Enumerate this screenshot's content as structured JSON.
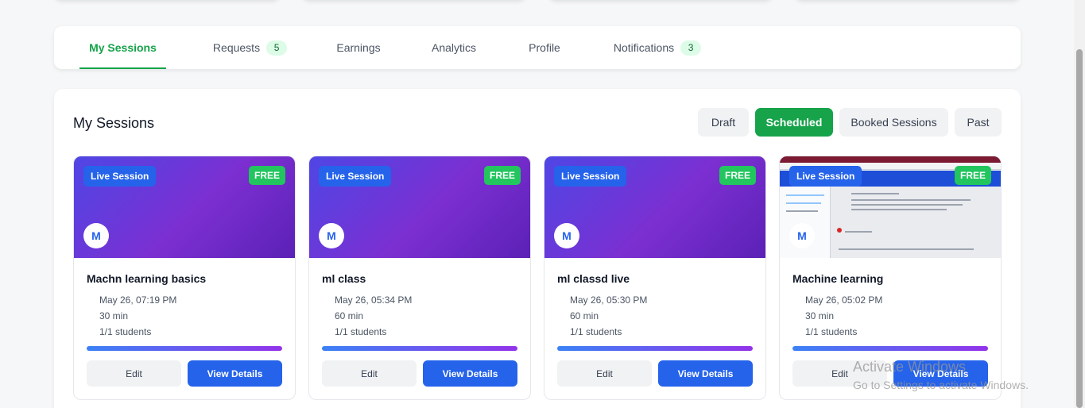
{
  "tabs": [
    {
      "label": "My Sessions",
      "active": true
    },
    {
      "label": "Requests",
      "count": "5"
    },
    {
      "label": "Earnings"
    },
    {
      "label": "Analytics"
    },
    {
      "label": "Profile"
    },
    {
      "label": "Notifications",
      "count": "3"
    }
  ],
  "panel": {
    "title": "My Sessions",
    "filters": [
      "Draft",
      "Scheduled",
      "Booked Sessions",
      "Past"
    ],
    "active_filter": "Scheduled"
  },
  "sessions": [
    {
      "badge": "Live Session",
      "price": "FREE",
      "avatar": "M",
      "title": "Machn learning basics",
      "datetime": "May 26, 07:19 PM",
      "duration": "30 min",
      "students": "1/1 students",
      "edit": "Edit",
      "view": "View Details"
    },
    {
      "badge": "Live Session",
      "price": "FREE",
      "avatar": "M",
      "title": "ml class",
      "datetime": "May 26, 05:34 PM",
      "duration": "60 min",
      "students": "1/1 students",
      "edit": "Edit",
      "view": "View Details"
    },
    {
      "badge": "Live Session",
      "price": "FREE",
      "avatar": "M",
      "title": "ml classd live",
      "datetime": "May 26, 05:30 PM",
      "duration": "60 min",
      "students": "1/1 students",
      "edit": "Edit",
      "view": "View Details"
    },
    {
      "badge": "Live Session",
      "price": "FREE",
      "avatar": "M",
      "title": "Machine learning",
      "datetime": "May 26, 05:02 PM",
      "duration": "30 min",
      "students": "1/1 students",
      "edit": "Edit",
      "view": "View Details"
    }
  ],
  "watermark": {
    "line1": "Activate Windows",
    "line2": "Go to Settings to activate Windows."
  },
  "colors": {
    "accent_green": "#16a34a",
    "primary_blue": "#2563eb",
    "free_badge": "#22c55e"
  }
}
